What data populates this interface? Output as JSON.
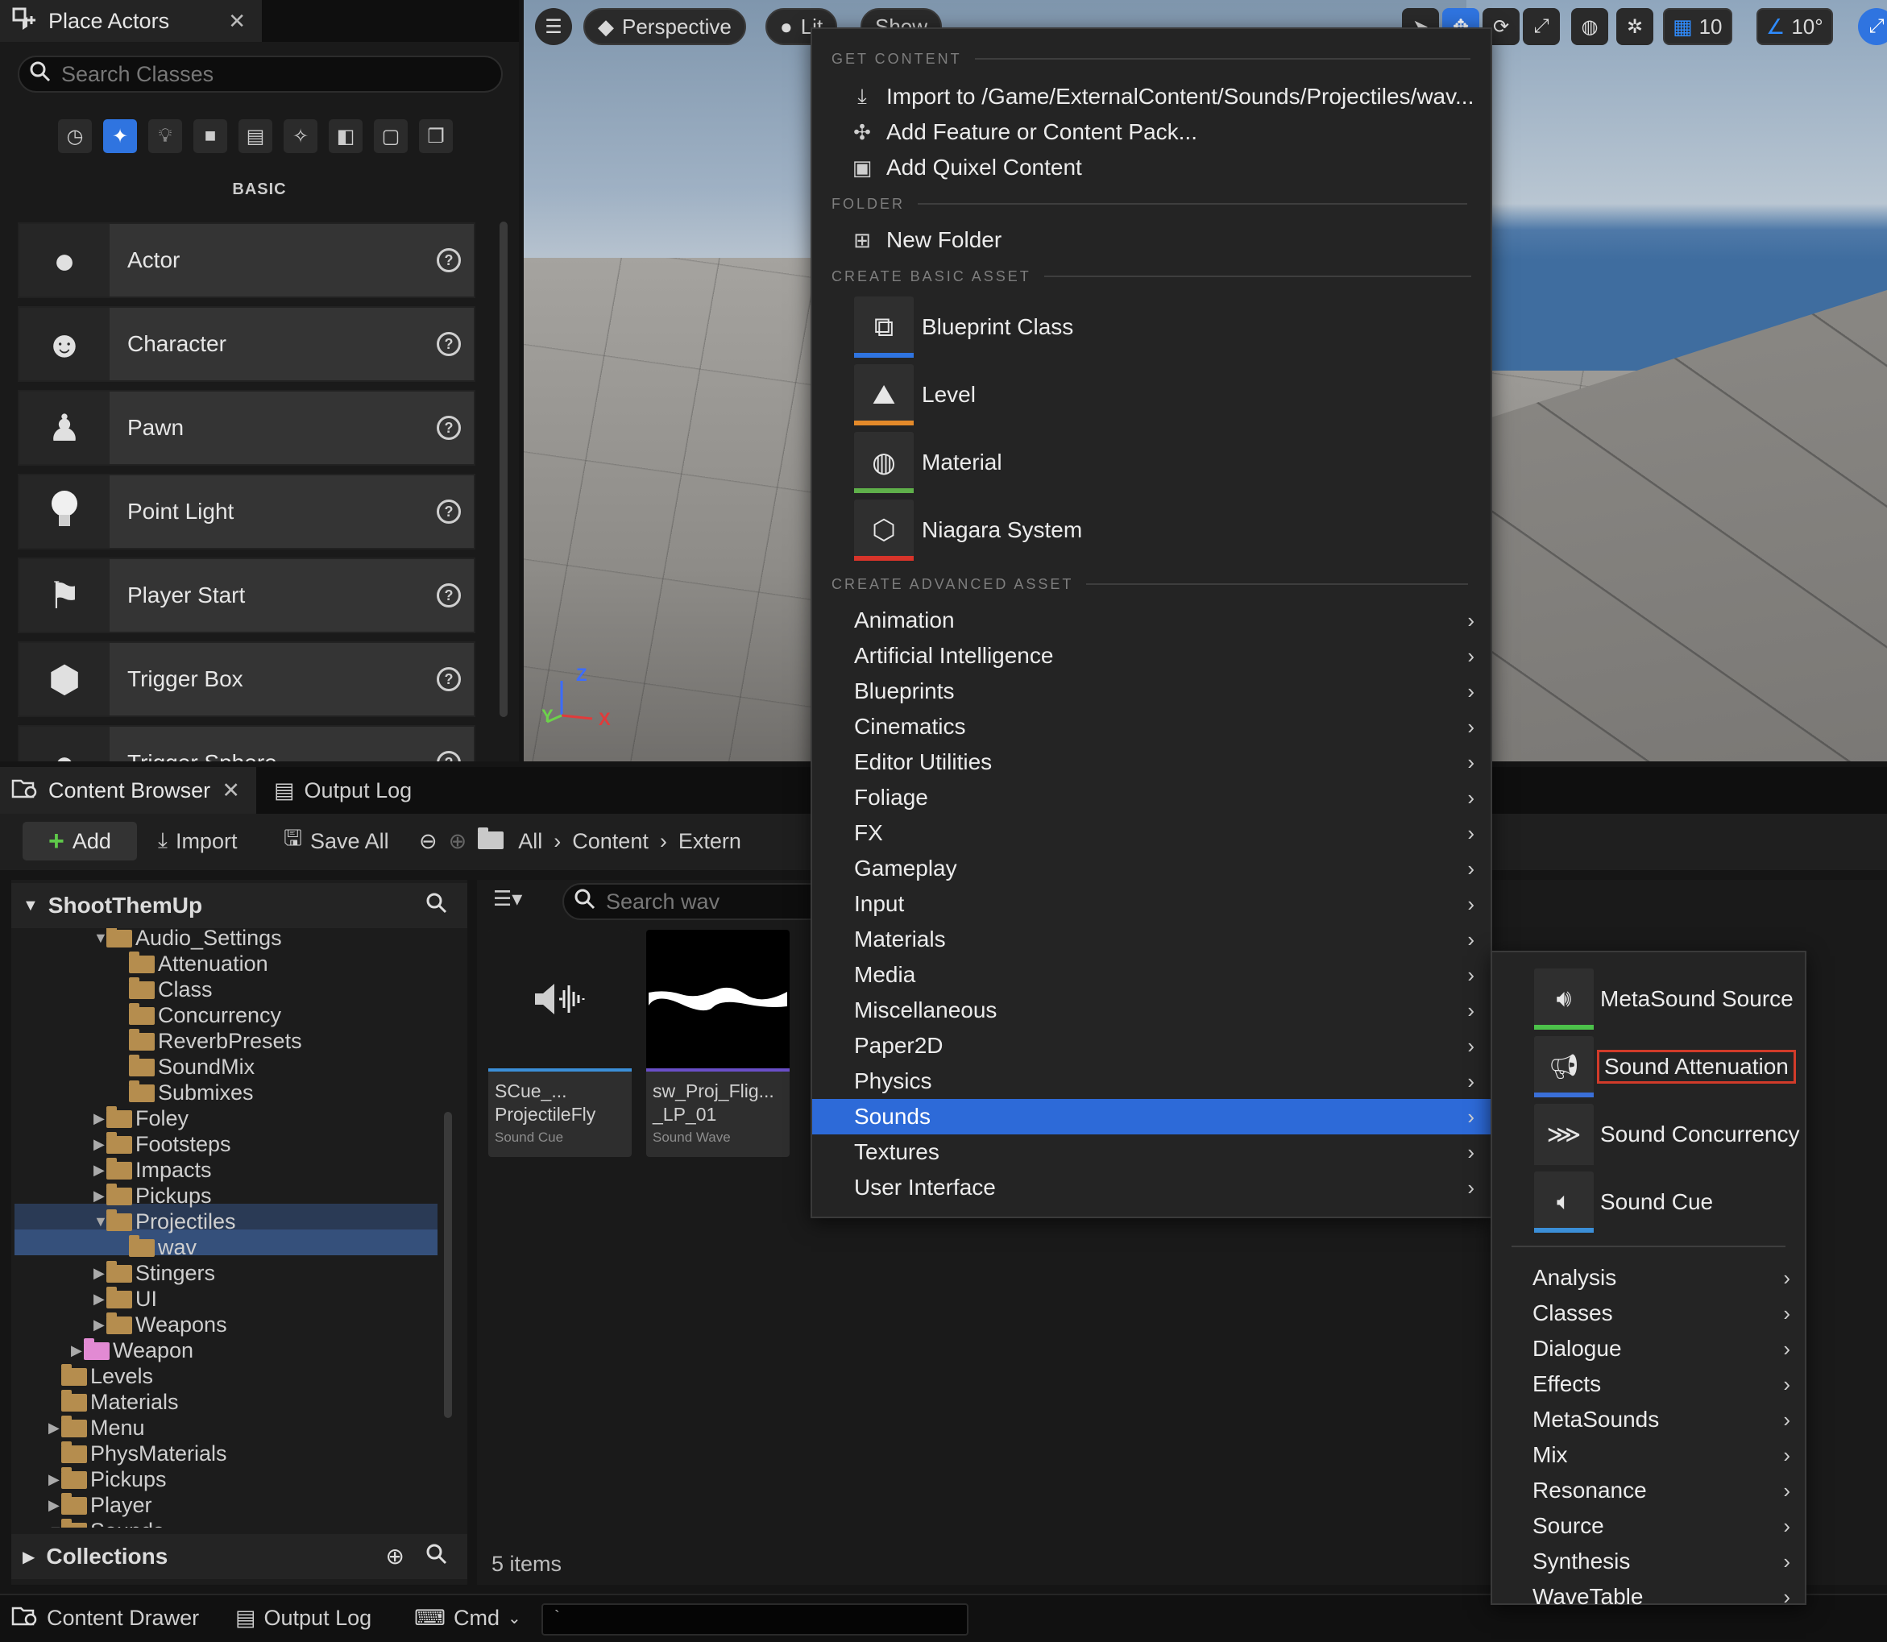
{
  "place_actors": {
    "tab_title": "Place Actors",
    "search_placeholder": "Search Classes",
    "category_label": "BASIC",
    "categories": [
      "recent-icon",
      "basic-icon",
      "lights-icon",
      "shapes-icon",
      "cinematic-icon",
      "visual-effects-icon",
      "geometry-icon",
      "volumes-icon",
      "all-classes-icon"
    ],
    "items": [
      {
        "label": "Actor",
        "icon": "sphere-icon"
      },
      {
        "label": "Character",
        "icon": "character-icon"
      },
      {
        "label": "Pawn",
        "icon": "pawn-icon"
      },
      {
        "label": "Point Light",
        "icon": "light-bulb-icon"
      },
      {
        "label": "Player Start",
        "icon": "player-start-icon"
      },
      {
        "label": "Trigger Box",
        "icon": "trigger-box-icon"
      },
      {
        "label": "Trigger Sphere",
        "icon": "trigger-sphere-icon"
      }
    ]
  },
  "viewport": {
    "perspective_label": "Perspective",
    "lit_label": "Lit",
    "show_label": "Show",
    "grid_snap_value": "10",
    "rotation_snap_value": "10°",
    "axis": {
      "z": "Z",
      "y": "Y",
      "x": "X"
    }
  },
  "content_browser": {
    "tab_title": "Content Browser",
    "output_log_tab": "Output Log",
    "toolbar": {
      "add_label": "Add",
      "import_label": "Import",
      "save_all_label": "Save All",
      "breadcrumb": [
        "All",
        "Content",
        "Extern"
      ]
    },
    "tree": {
      "root": "ShootThemUp",
      "rows": [
        {
          "label": "Audio_Settings",
          "depth": 2,
          "expanded": true
        },
        {
          "label": "Attenuation",
          "depth": 3
        },
        {
          "label": "Class",
          "depth": 3
        },
        {
          "label": "Concurrency",
          "depth": 3
        },
        {
          "label": "ReverbPresets",
          "depth": 3
        },
        {
          "label": "SoundMix",
          "depth": 3
        },
        {
          "label": "Submixes",
          "depth": 3
        },
        {
          "label": "Foley",
          "depth": 2,
          "collapsed": true
        },
        {
          "label": "Footsteps",
          "depth": 2,
          "collapsed": true
        },
        {
          "label": "Impacts",
          "depth": 2,
          "collapsed": true
        },
        {
          "label": "Pickups",
          "depth": 2,
          "collapsed": true
        },
        {
          "label": "Projectiles",
          "depth": 2,
          "expanded": true
        },
        {
          "label": "wav",
          "depth": 3
        },
        {
          "label": "Stingers",
          "depth": 2,
          "collapsed": true
        },
        {
          "label": "UI",
          "depth": 2,
          "collapsed": true
        },
        {
          "label": "Weapons",
          "depth": 2,
          "collapsed": true
        },
        {
          "label": "Weapon",
          "depth": 1,
          "collapsed": true,
          "pink": true
        },
        {
          "label": "Levels",
          "depth": 0
        },
        {
          "label": "Materials",
          "depth": 0
        },
        {
          "label": "Menu",
          "depth": 0,
          "collapsed": true
        },
        {
          "label": "PhysMaterials",
          "depth": 0
        },
        {
          "label": "Pickups",
          "depth": 0,
          "collapsed": true
        },
        {
          "label": "Player",
          "depth": 0,
          "collapsed": true
        },
        {
          "label": "Sounds",
          "depth": 0,
          "expanded": true
        }
      ]
    },
    "collections_label": "Collections",
    "search_placeholder": "Search wav",
    "assets": [
      {
        "name": "SCue_... ProjectileFly",
        "type": "Sound Cue",
        "bar_color": "#3b8fd8"
      },
      {
        "name": "sw_Proj_Flig... _LP_01",
        "type": "Sound Wave",
        "bar_color": "#6a4fc8"
      }
    ],
    "items_count": "5 items"
  },
  "status_bar": {
    "content_drawer": "Content Drawer",
    "output_log": "Output Log",
    "cmd_label": "Cmd",
    "cmd_value": "`"
  },
  "context_menu": {
    "get_content_header": "GET CONTENT",
    "get_content_items": [
      {
        "label": "Import to /Game/ExternalContent/Sounds/Projectiles/wav...",
        "icon": "import-icon"
      },
      {
        "label": "Add Feature or Content Pack...",
        "icon": "content-pack-icon"
      },
      {
        "label": "Add Quixel Content",
        "icon": "quixel-icon"
      }
    ],
    "folder_header": "FOLDER",
    "new_folder_label": "New Folder",
    "basic_asset_header": "CREATE BASIC ASSET",
    "basic_assets": [
      {
        "label": "Blueprint Class",
        "stripe": "#2f74e0"
      },
      {
        "label": "Level",
        "stripe": "#e48a2a"
      },
      {
        "label": "Material",
        "stripe": "#5fb04a"
      },
      {
        "label": "Niagara System",
        "stripe": "#d8342a"
      }
    ],
    "advanced_asset_header": "CREATE ADVANCED ASSET",
    "advanced_items": [
      "Animation",
      "Artificial Intelligence",
      "Blueprints",
      "Cinematics",
      "Editor Utilities",
      "Foliage",
      "FX",
      "Gameplay",
      "Input",
      "Materials",
      "Media",
      "Miscellaneous",
      "Paper2D",
      "Physics",
      "Sounds",
      "Textures",
      "User Interface"
    ],
    "highlighted": "Sounds"
  },
  "sounds_submenu": {
    "assets": [
      {
        "label": "MetaSound Source",
        "stripe": "#4cc24a"
      },
      {
        "label": "Sound Attenuation",
        "stripe": "#3a6fd8",
        "boxed": true
      },
      {
        "label": "Sound Concurrency",
        "stripe": "#2f2f2f"
      },
      {
        "label": "Sound Cue",
        "stripe": "#3b8fd8"
      }
    ],
    "categories": [
      "Analysis",
      "Classes",
      "Dialogue",
      "Effects",
      "MetaSounds",
      "Mix",
      "Resonance",
      "Source",
      "Synthesis",
      "WaveTable"
    ]
  }
}
